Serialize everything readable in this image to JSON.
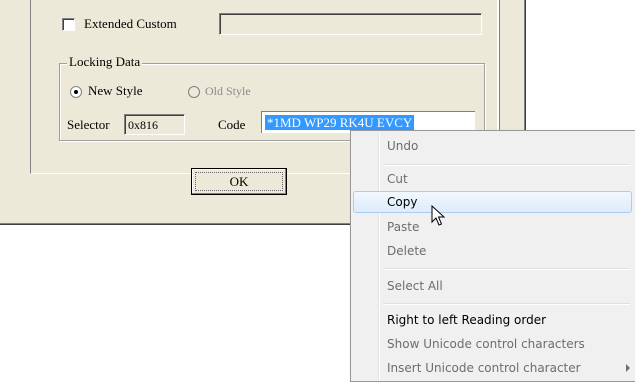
{
  "dialog": {
    "extended_custom": {
      "label": "Extended Custom",
      "checked": false,
      "value": ""
    },
    "locking": {
      "legend": "Locking Data",
      "new_style": "New Style",
      "old_style": "Old Style",
      "selected": "New Style",
      "selector_label": "Selector",
      "selector_value": "0x816",
      "code_label": "Code",
      "code_value": "*1MD WP29 RK4U EVCY"
    },
    "ok_label": "OK"
  },
  "context_menu": {
    "items": [
      {
        "label": "Undo",
        "enabled": false
      },
      {
        "label": "Cut",
        "enabled": false
      },
      {
        "label": "Copy",
        "enabled": true,
        "highlighted": true
      },
      {
        "label": "Paste",
        "enabled": false
      },
      {
        "label": "Delete",
        "enabled": false
      },
      {
        "label": "Select All",
        "enabled": false
      },
      {
        "label": "Right to left Reading order",
        "enabled": true
      },
      {
        "label": "Show Unicode control characters",
        "enabled": false
      },
      {
        "label": "Insert Unicode control character",
        "enabled": false,
        "submenu": true
      }
    ]
  },
  "colors": {
    "dialog_bg": "#ece9d8",
    "selection": "#3399ff",
    "menu_highlight_border": "#aeccf0"
  }
}
